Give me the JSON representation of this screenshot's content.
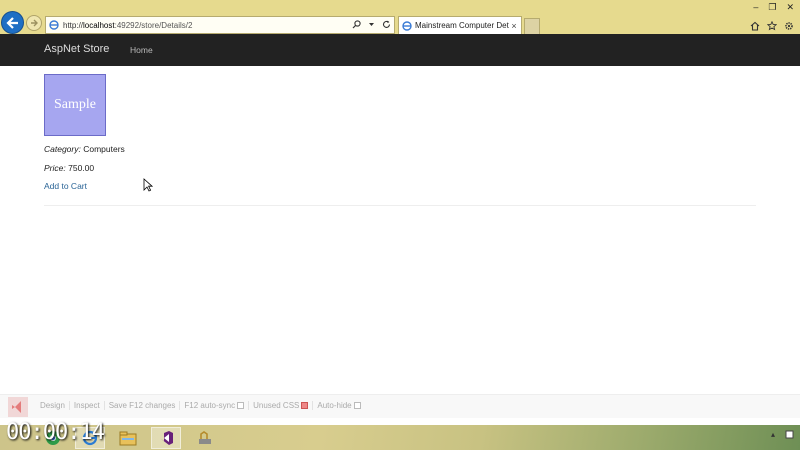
{
  "browser": {
    "url_prefix": "http://",
    "url_host": "localhost",
    "url_rest": ":49292/store/Details/2",
    "tab_title": "Mainstream Computer Det...",
    "tab_close": "×",
    "window_controls": [
      "–",
      "❐",
      "✕"
    ]
  },
  "navbar": {
    "brand": "AspNet Store",
    "home": "Home"
  },
  "product": {
    "image_label": "Sample",
    "category_label": "Category:",
    "category_value": "Computers",
    "price_label": "Price:",
    "price_value": "750.00",
    "add_to_cart": "Add to Cart"
  },
  "browserlink": {
    "design": "Design",
    "inspect": "Inspect",
    "save": "Save F12 changes",
    "autosync": "F12 auto-sync",
    "unused_css": "Unused CSS",
    "autohide": "Auto-hide"
  },
  "overlay": {
    "timer": "00:00:14"
  },
  "colors": {
    "chrome_bg": "#e6da8e",
    "navbar_bg": "#222222",
    "image_bg": "#a6a6f0",
    "link": "#2a6496"
  }
}
